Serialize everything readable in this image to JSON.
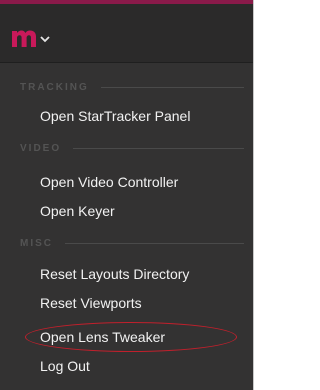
{
  "menu": {
    "sections": [
      {
        "label": "TRACKING",
        "items": [
          "Open StarTracker Panel"
        ]
      },
      {
        "label": "VIDEO",
        "items": [
          "Open Video Controller",
          "Open Keyer"
        ]
      },
      {
        "label": "MISC",
        "items": [
          "Reset Layouts Directory",
          "Reset Viewports",
          "Open Lens Tweaker",
          "Log Out"
        ]
      }
    ]
  },
  "logo": {
    "icon": "m-logo-icon",
    "dropdown_icon": "chevron-down-icon"
  },
  "colors": {
    "logo_magenta": "#c8195a",
    "panel_background": "#333232",
    "highlight_annotation": "#c0202c"
  }
}
